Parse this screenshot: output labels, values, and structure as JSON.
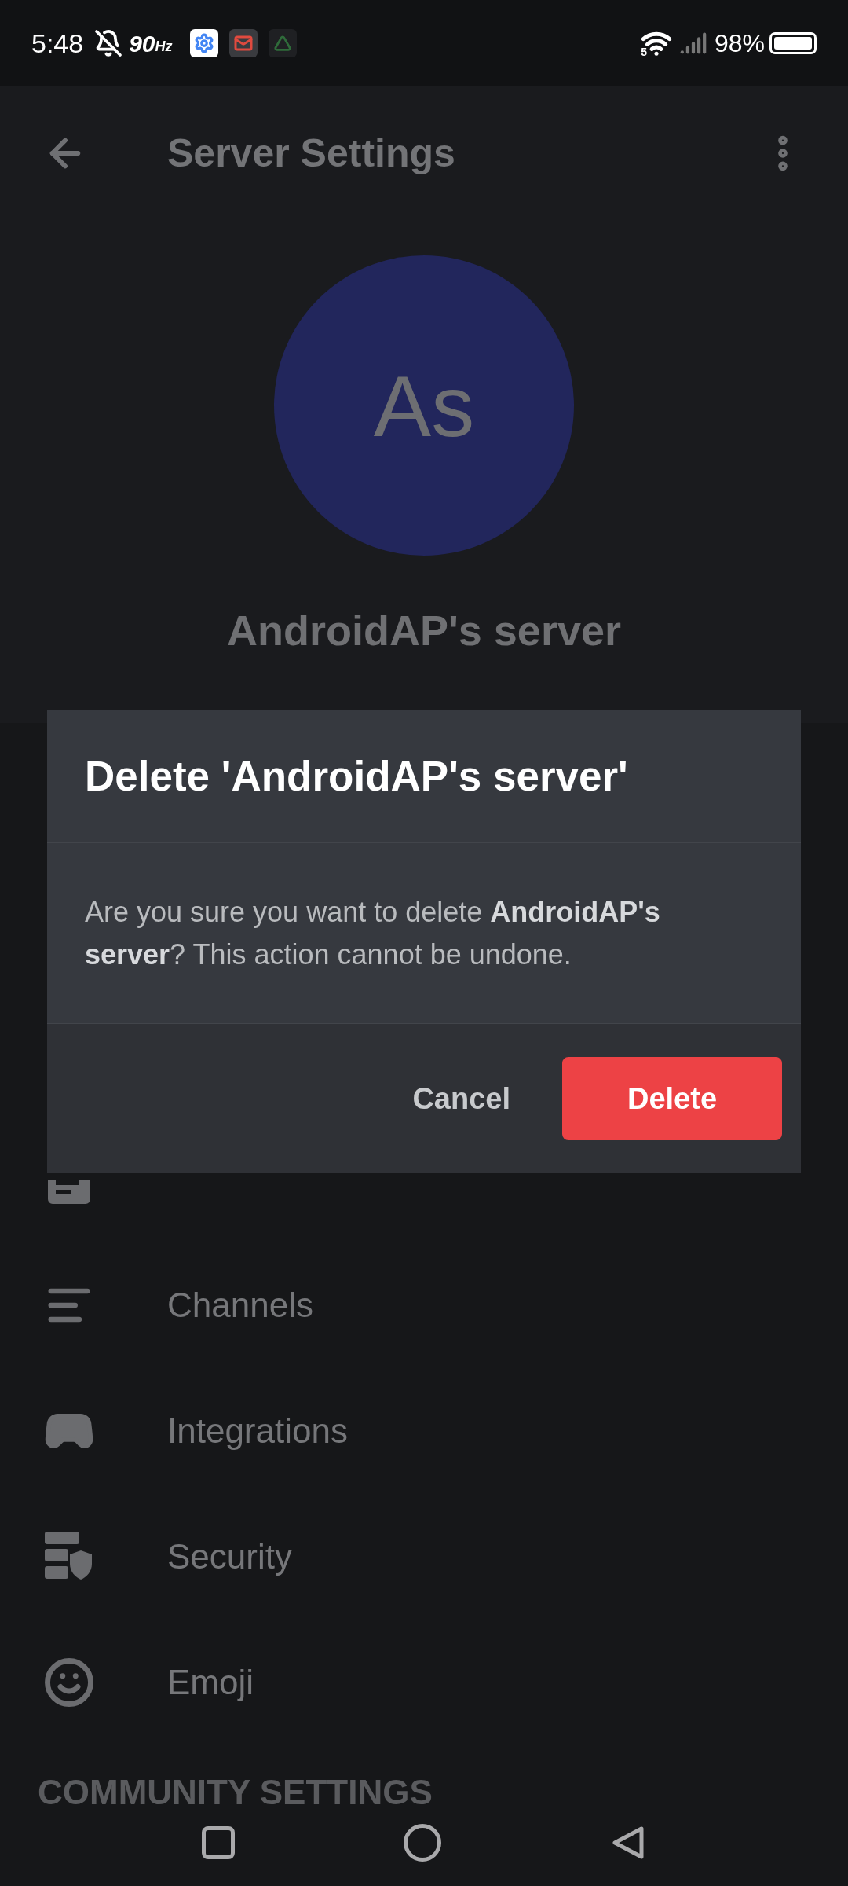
{
  "status_bar": {
    "time": "5:48",
    "refresh_rate": "90",
    "refresh_unit": "Hz",
    "wifi_band": "5",
    "battery": "98%"
  },
  "app_bar": {
    "title": "Server Settings"
  },
  "server": {
    "initials": "As",
    "name": "AndroidAP's server"
  },
  "menu": [
    {
      "kind": "hidden"
    },
    {
      "kind": "hidden"
    },
    {
      "kind": "audit"
    },
    {
      "kind": "channels",
      "label": "Channels"
    },
    {
      "kind": "integrations",
      "label": "Integrations"
    },
    {
      "kind": "security",
      "label": "Security"
    },
    {
      "kind": "emoji",
      "label": "Emoji"
    }
  ],
  "community_header": "COMMUNITY SETTINGS",
  "dialog": {
    "title": "Delete 'AndroidAP's server'",
    "message": "Are you sure you want to delete **AndroidAP's server**? This action cannot be undone.",
    "cancel": "Cancel",
    "confirm": "Delete"
  }
}
